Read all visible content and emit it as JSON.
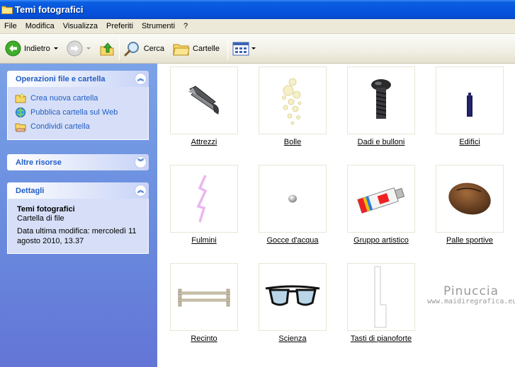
{
  "window": {
    "title": "Temi fotografici"
  },
  "menu": [
    "File",
    "Modifica",
    "Visualizza",
    "Preferiti",
    "Strumenti",
    "?"
  ],
  "toolbar": {
    "back": "Indietro",
    "search": "Cerca",
    "folders": "Cartelle"
  },
  "panels": {
    "tasks": {
      "title": "Operazioni file e cartella",
      "items": [
        "Crea nuova cartella",
        "Pubblica cartella sul Web",
        "Condividi cartella"
      ]
    },
    "other": {
      "title": "Altre risorse"
    },
    "details": {
      "title": "Dettagli",
      "name": "Temi fotografici",
      "type": "Cartella di file",
      "modified_1": "Data ultima modifica: mercoledì 11",
      "modified_2": "agosto 2010, 13.37"
    }
  },
  "items": [
    {
      "label": "Attrezzi",
      "icon": "stapler-icon"
    },
    {
      "label": "Bolle",
      "icon": "bubbles-icon"
    },
    {
      "label": "Dadi e bulloni",
      "icon": "bolt-icon"
    },
    {
      "label": "Edifici",
      "icon": "building-icon"
    },
    {
      "label": "Fulmini",
      "icon": "lightning-icon"
    },
    {
      "label": "Gocce d'acqua",
      "icon": "water-drop-icon"
    },
    {
      "label": "Gruppo artistico",
      "icon": "paint-tube-icon"
    },
    {
      "label": "Palle sportive",
      "icon": "football-icon"
    },
    {
      "label": "Recinto",
      "icon": "fence-icon"
    },
    {
      "label": "Scienza",
      "icon": "glasses-icon"
    },
    {
      "label": "Tasti di pianoforte",
      "icon": "piano-key-icon"
    }
  ],
  "watermark": {
    "name": "Pinuccia",
    "site": "www.maidiregrafica.eu"
  }
}
